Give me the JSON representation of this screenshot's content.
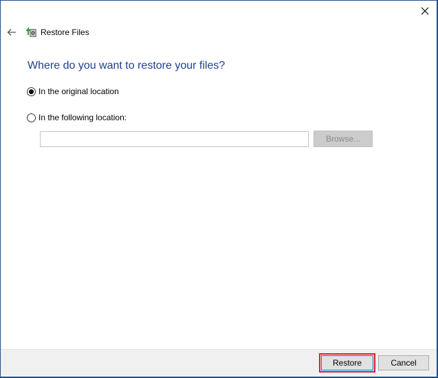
{
  "window": {
    "title": "Restore Files",
    "close_icon": "close-icon",
    "back_icon": "arrow-left-icon",
    "app_icon": "restore-files-icon"
  },
  "main": {
    "heading": "Where do you want to restore your files?",
    "options": [
      {
        "label": "In the original location",
        "selected": true
      },
      {
        "label": "In the following location:",
        "selected": false
      }
    ],
    "location_input": {
      "value": "",
      "placeholder": ""
    },
    "browse_label": "Browse...",
    "browse_enabled": false
  },
  "footer": {
    "restore_label": "Restore",
    "cancel_label": "Cancel"
  },
  "colors": {
    "heading": "#1e3f8f",
    "focus_highlight": "#d0202f",
    "footer_bg": "#f0f0f0"
  }
}
